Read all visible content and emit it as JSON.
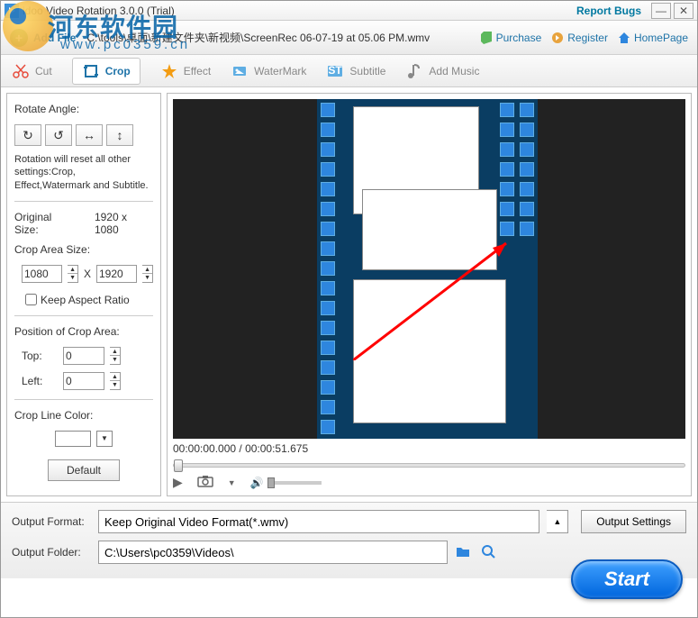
{
  "window": {
    "title": "idoo Video Rotation 3.0.0 (Trial)",
    "report_bugs": "Report Bugs"
  },
  "watermark": {
    "text": "河东软件园",
    "sub": "www.pc0359.cn"
  },
  "toolbar1": {
    "addfile": "Add File",
    "filepath": "C:\\tools\\桌面\\新建文件夹\\新视频\\ScreenRec 06-07-19 at 05.06 PM.wmv",
    "purchase": "Purchase",
    "register": "Register",
    "homepage": "HomePage"
  },
  "toolbar2": {
    "cut": "Cut",
    "crop": "Crop",
    "effect": "Effect",
    "watermark": "WaterMark",
    "subtitle": "Subtitle",
    "addmusic": "Add Music"
  },
  "side": {
    "rotate_label": "Rotate Angle:",
    "warn": "Rotation will reset all other settings:Crop, Effect,Watermark and Subtitle.",
    "orig_label": "Original Size:",
    "orig_value": "1920 x 1080",
    "crop_label": "Crop Area Size:",
    "crop_w": "1080",
    "crop_x": "X",
    "crop_h": "1920",
    "keep_ratio": "Keep Aspect Ratio",
    "pos_label": "Position of Crop Area:",
    "top_label": "Top:",
    "top_val": "0",
    "left_label": "Left:",
    "left_val": "0",
    "color_label": "Crop Line Color:",
    "default": "Default"
  },
  "preview": {
    "time": "00:00:00.000 / 00:00:51.675"
  },
  "bottom": {
    "format_label": "Output Format:",
    "format_value": "Keep Original Video Format(*.wmv)",
    "output_settings": "Output Settings",
    "folder_label": "Output Folder:",
    "folder_value": "C:\\Users\\pc0359\\Videos\\",
    "start": "Start"
  }
}
